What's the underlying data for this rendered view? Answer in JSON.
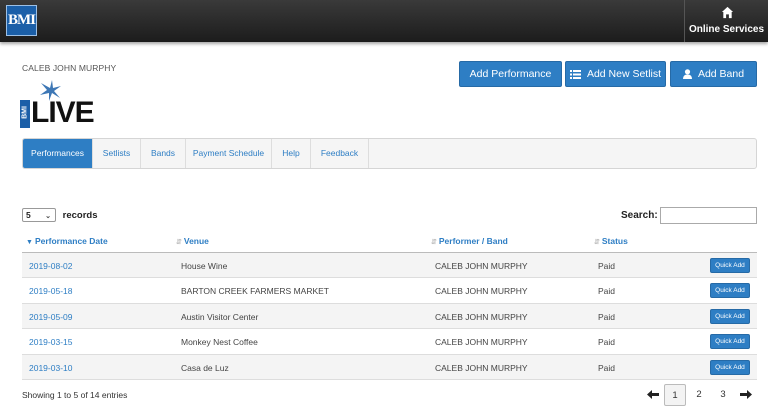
{
  "header": {
    "logo_text": "BMI",
    "online_services_label": "Online Services"
  },
  "account": {
    "name": "CALEB JOHN MURPHY"
  },
  "actions": {
    "add_performance": "Add Performance",
    "add_setlist": "Add New Setlist",
    "add_band": "Add Band"
  },
  "brand": {
    "live_vertical": "BMI",
    "live_word": "LIVE"
  },
  "tabs": [
    {
      "label": "Performances",
      "active": true
    },
    {
      "label": "Setlists"
    },
    {
      "label": "Bands"
    },
    {
      "label": "Payment Schedule"
    },
    {
      "label": "Help"
    },
    {
      "label": "Feedback"
    }
  ],
  "table_controls": {
    "page_length": "5",
    "records_label": "records",
    "search_label": "Search:",
    "search_value": ""
  },
  "columns": [
    "Performance Date",
    "Venue",
    "Performer / Band",
    "Status"
  ],
  "rows": [
    {
      "date": "2019-08-02",
      "venue": "House Wine",
      "performer": "CALEB JOHN MURPHY",
      "status": "Paid",
      "action": "Quick Add"
    },
    {
      "date": "2019-05-18",
      "venue": "BARTON CREEK FARMERS MARKET",
      "performer": "CALEB JOHN MURPHY",
      "status": "Paid",
      "action": "Quick Add"
    },
    {
      "date": "2019-05-09",
      "venue": "Austin Visitor Center",
      "performer": "CALEB JOHN MURPHY",
      "status": "Paid",
      "action": "Quick Add"
    },
    {
      "date": "2019-03-15",
      "venue": "Monkey Nest Coffee",
      "performer": "CALEB JOHN MURPHY",
      "status": "Paid",
      "action": "Quick Add"
    },
    {
      "date": "2019-03-10",
      "venue": "Casa de Luz",
      "performer": "CALEB JOHN MURPHY",
      "status": "Paid",
      "action": "Quick Add"
    }
  ],
  "footer": {
    "info": "Showing 1 to 5 of 14 entries",
    "pages": [
      "1",
      "2",
      "3"
    ],
    "current_page": "1"
  },
  "colors": {
    "accent": "#2e7ec4",
    "topbar": "#2a2a2a",
    "brand_blue": "#1b5fa8"
  },
  "icons": [
    "home-icon",
    "list-icon",
    "user-icon",
    "arrow-left-icon",
    "arrow-right-icon",
    "sort-desc-icon",
    "sort-both-icon"
  ]
}
